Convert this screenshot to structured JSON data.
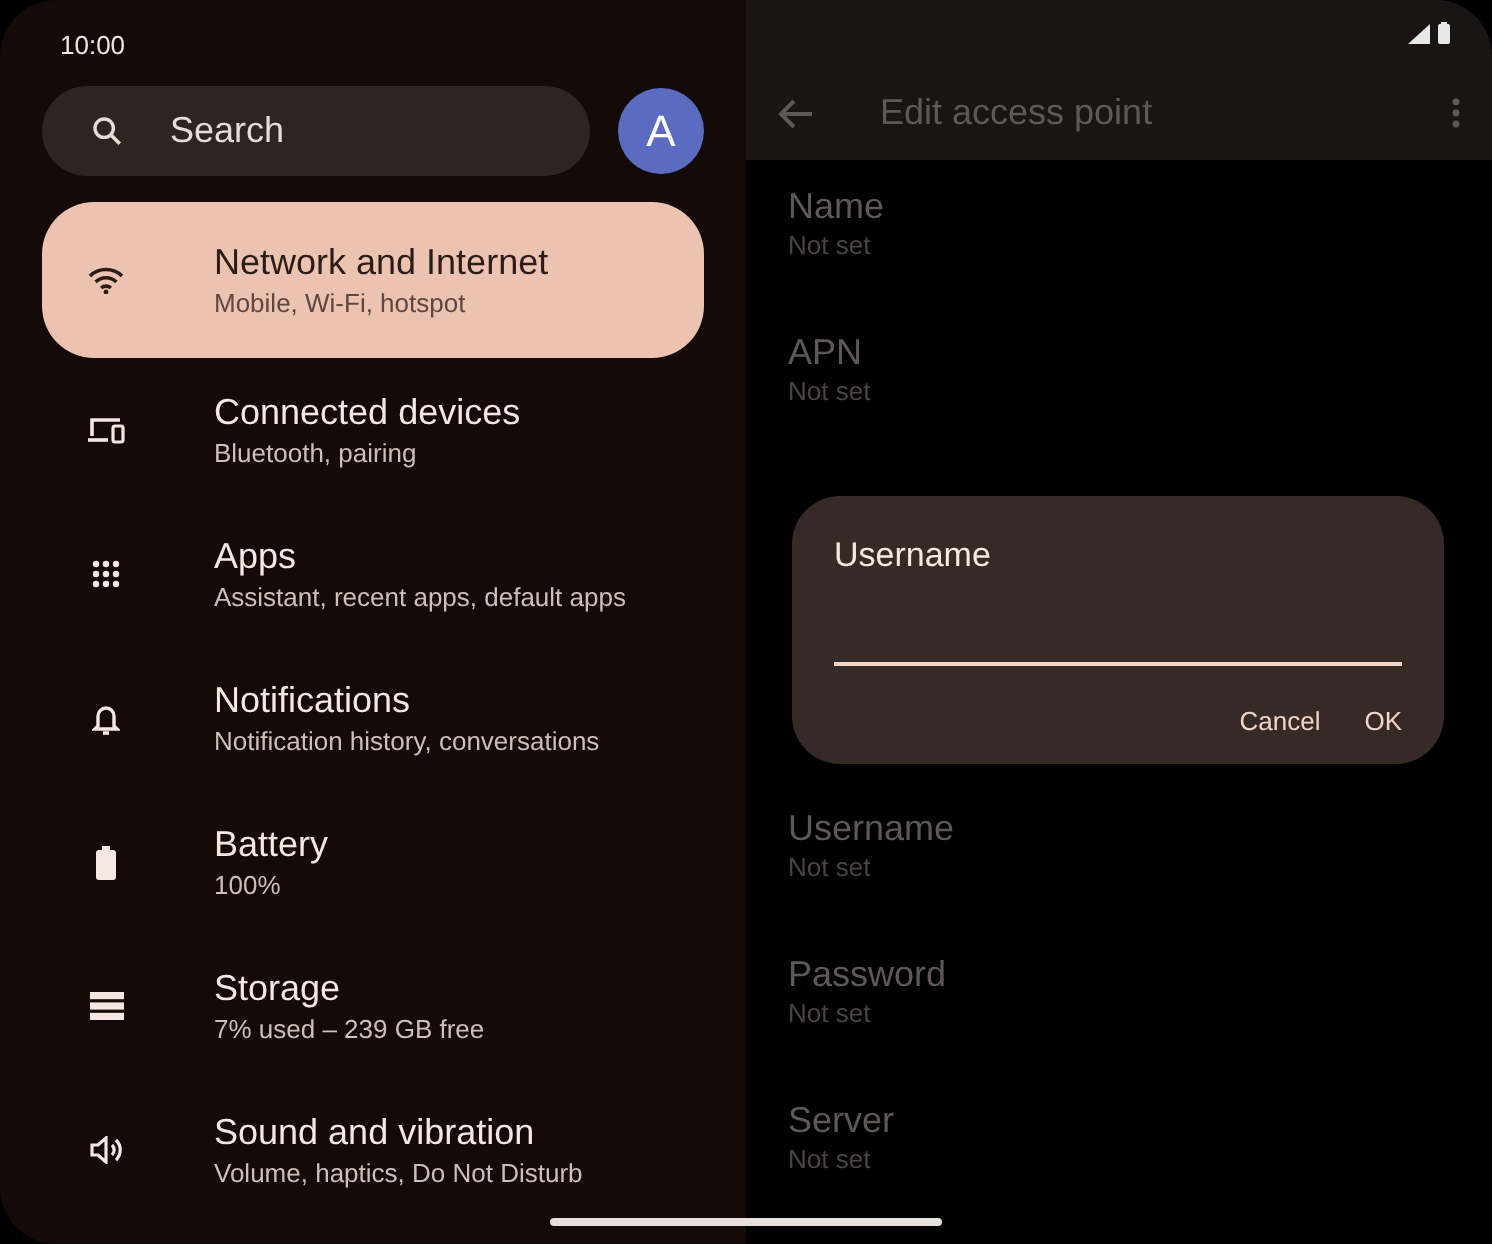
{
  "status_bar": {
    "time": "10:00"
  },
  "search": {
    "placeholder": "Search"
  },
  "avatar": {
    "letter": "A"
  },
  "settings": [
    {
      "title": "Network and Internet",
      "subtitle": "Mobile, Wi-Fi, hotspot",
      "selected": true
    },
    {
      "title": "Connected devices",
      "subtitle": "Bluetooth, pairing",
      "selected": false
    },
    {
      "title": "Apps",
      "subtitle": "Assistant, recent apps, default apps",
      "selected": false
    },
    {
      "title": "Notifications",
      "subtitle": "Notification history, conversations",
      "selected": false
    },
    {
      "title": "Battery",
      "subtitle": "100%",
      "selected": false
    },
    {
      "title": "Storage",
      "subtitle": "7% used – 239 GB free",
      "selected": false
    },
    {
      "title": "Sound and vibration",
      "subtitle": "Volume, haptics, Do Not Disturb",
      "selected": false
    }
  ],
  "detail": {
    "title": "Edit access point",
    "fields_top": [
      {
        "label": "Name",
        "value": "Not set"
      },
      {
        "label": "APN",
        "value": "Not set"
      }
    ],
    "fields_bottom": [
      {
        "label": "Username",
        "value": "Not set"
      },
      {
        "label": "Password",
        "value": "Not set"
      },
      {
        "label": "Server",
        "value": "Not set"
      }
    ]
  },
  "dialog": {
    "title": "Username",
    "buttons": [
      "Cancel",
      "OK"
    ]
  }
}
